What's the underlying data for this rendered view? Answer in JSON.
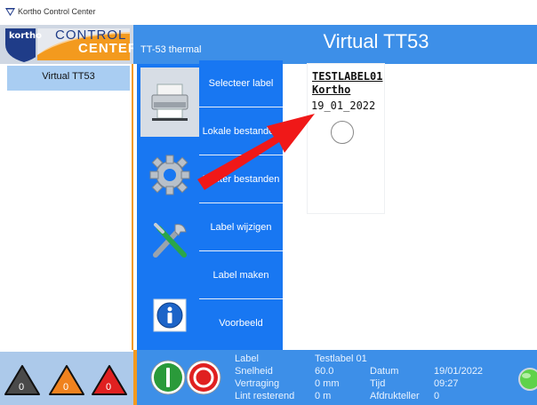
{
  "window": {
    "title": "Kortho Control Center"
  },
  "logo": {
    "brand": "kortho",
    "product_line1": "CONTROL",
    "product_line2": "CENTER"
  },
  "header": {
    "printer_type": "TT-53 thermal",
    "printer_name": "Virtual TT53"
  },
  "sidebar": {
    "printers": [
      {
        "label": "Virtual TT53"
      }
    ]
  },
  "icon_buttons": [
    {
      "icon": "printer-icon",
      "active": true
    },
    {
      "icon": "gear-icon",
      "active": false
    },
    {
      "icon": "tools-icon",
      "active": false
    },
    {
      "icon": "info-icon",
      "active": false
    }
  ],
  "menu": {
    "items": [
      {
        "label": "Selecteer label"
      },
      {
        "label": "Lokale bestanden"
      },
      {
        "label": "Printer bestanden"
      },
      {
        "label": "Label wijzigen"
      },
      {
        "label": "Label maken"
      },
      {
        "label": "Voorbeeld"
      }
    ]
  },
  "label_preview": {
    "line1": "TESTLABEL01",
    "line2": "Kortho",
    "line3": "19_01_2022"
  },
  "alerts": [
    {
      "count": "0",
      "color": "#4a4a4a"
    },
    {
      "count": "0",
      "color": "#f0821e"
    },
    {
      "count": "0",
      "color": "#e02020"
    }
  ],
  "status": {
    "label_key": "Label",
    "label_val": "Testlabel 01",
    "speed_key": "Snelheid",
    "speed_val": "60.0",
    "date_key": "Datum",
    "date_val": "19/01/2022",
    "delay_key": "Vertraging",
    "delay_val": "0 mm",
    "time_key": "Tijd",
    "time_val": "09:27",
    "ribbon_key": "Lint resterend",
    "ribbon_val": "0 m",
    "count_key": "Afdrukteller",
    "count_val": "0"
  },
  "colors": {
    "accent": "#1877f2",
    "header": "#3d8fe8",
    "divider": "#f39a1e",
    "start": "#2a9a3a",
    "stop": "#e02020"
  }
}
